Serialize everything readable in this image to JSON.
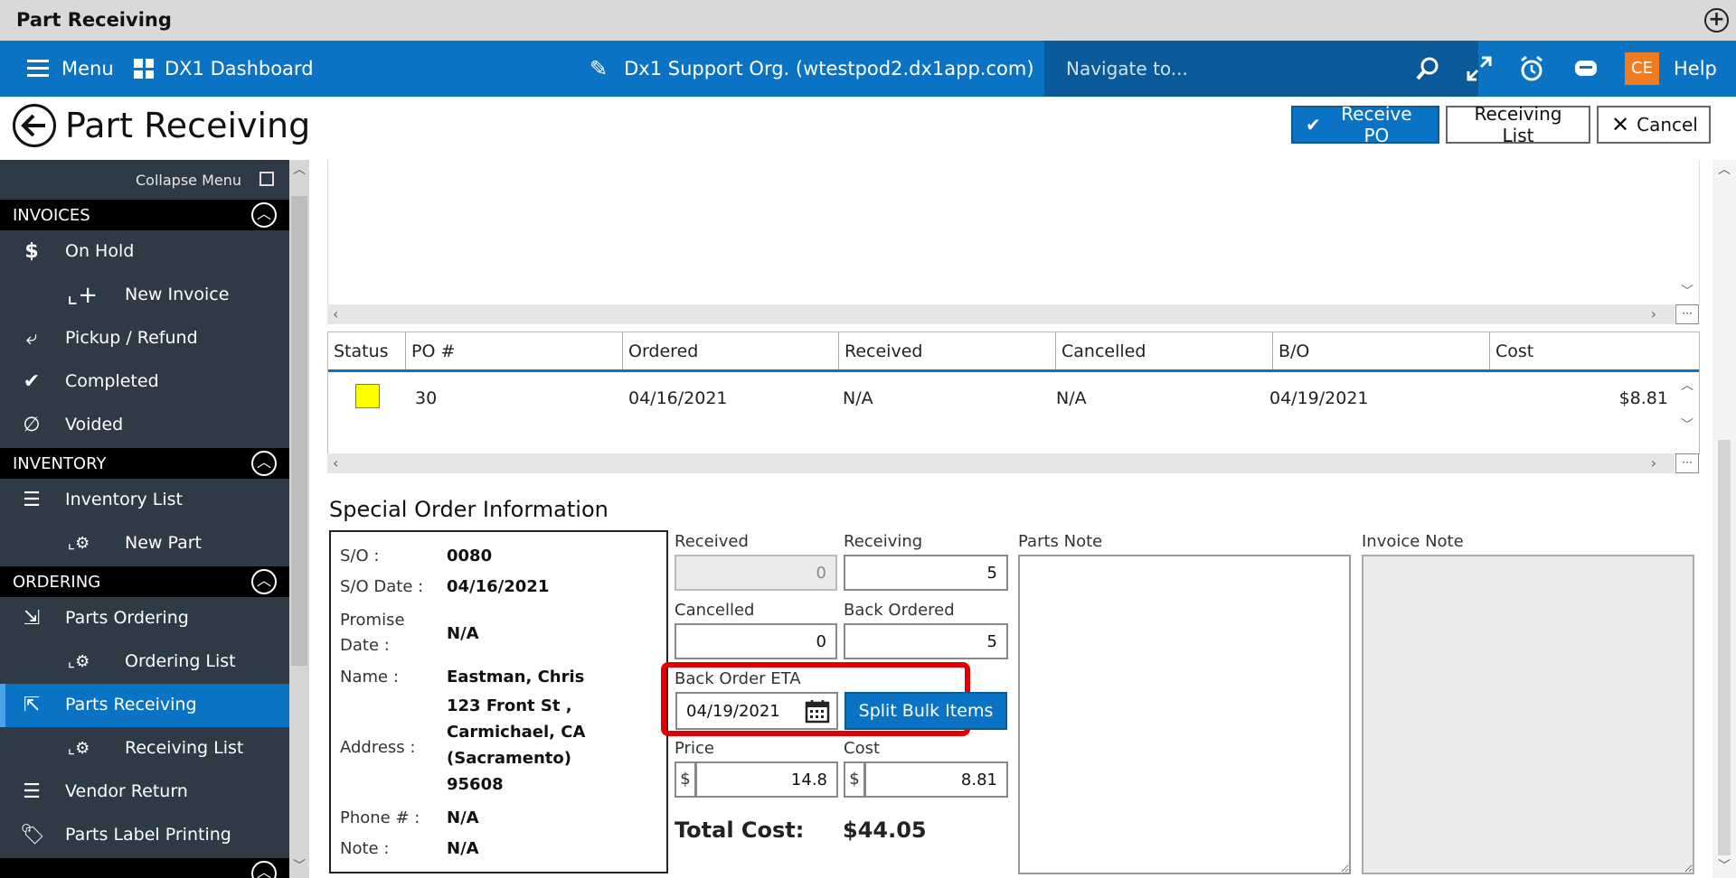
{
  "window": {
    "title": "Part Receiving"
  },
  "nav": {
    "menu_label": "Menu",
    "dashboard_label": "DX1 Dashboard",
    "org_label": "Dx1 Support Org. (wtestpod2.dx1app.com)",
    "search_placeholder": "Navigate to...",
    "user_initials": "CE",
    "help_label": "Help",
    "accent_color": "#0b73c4",
    "user_badge_color": "#f07b21"
  },
  "header": {
    "title": "Part Receiving",
    "receive_po_label": "Receive PO",
    "receiving_list_label": "Receiving List",
    "cancel_label": "Cancel"
  },
  "sidebar": {
    "collapse_label": "Collapse Menu",
    "sections": [
      {
        "title": "INVOICES",
        "items": [
          {
            "label": "On Hold",
            "icon": "dollar-icon"
          },
          {
            "label": "New Invoice",
            "icon": "plus-icon",
            "sub": true
          },
          {
            "label": "Pickup / Refund",
            "icon": "refund-icon"
          },
          {
            "label": "Completed",
            "icon": "check-icon"
          },
          {
            "label": "Voided",
            "icon": "void-icon"
          }
        ]
      },
      {
        "title": "INVENTORY",
        "items": [
          {
            "label": "Inventory List",
            "icon": "list-icon"
          },
          {
            "label": "New Part",
            "icon": "gear-icon",
            "sub": true
          }
        ]
      },
      {
        "title": "ORDERING",
        "items": [
          {
            "label": "Parts Ordering",
            "icon": "order-icon"
          },
          {
            "label": "Ordering List",
            "icon": "gear-icon",
            "sub": true
          },
          {
            "label": "Parts Receiving",
            "icon": "receiving-icon",
            "active": true
          },
          {
            "label": "Receiving List",
            "icon": "gear-icon",
            "sub": true
          },
          {
            "label": "Vendor Return",
            "icon": "list-icon"
          },
          {
            "label": "Parts Label Printing",
            "icon": "label-icon"
          }
        ]
      }
    ]
  },
  "po_table": {
    "columns": [
      "Status",
      "PO #",
      "Ordered",
      "Received",
      "Cancelled",
      "B/O",
      "Cost"
    ],
    "rows": [
      {
        "status_color": "#ffff00",
        "po": "30",
        "ordered": "04/16/2021",
        "received": "N/A",
        "cancelled": "N/A",
        "bo": "04/19/2021",
        "cost": "$8.81"
      }
    ]
  },
  "special_order": {
    "title": "Special Order Information",
    "so_label": "S/O :",
    "so_value": "0080",
    "so_date_label": "S/O Date :",
    "so_date_value": "04/16/2021",
    "promise_label": "Promise Date :",
    "promise_value": "N/A",
    "name_label": "Name :",
    "name_value": "Eastman, Chris",
    "address_label": "Address :",
    "address_lines": [
      "123 Front St ,",
      "Carmichael, CA",
      "(Sacramento)",
      "95608"
    ],
    "phone_label": "Phone # :",
    "phone_value": "N/A",
    "note_label": "Note :",
    "note_value": "N/A"
  },
  "fields": {
    "received_label": "Received",
    "received_value": "0",
    "receiving_label": "Receiving",
    "receiving_value": "5",
    "cancelled_label": "Cancelled",
    "cancelled_value": "0",
    "back_ordered_label": "Back Ordered",
    "back_ordered_value": "5",
    "eta_label": "Back Order ETA",
    "eta_value": "04/19/2021",
    "split_label": "Split Bulk Items",
    "price_label": "Price",
    "price_value": "14.8",
    "cost_label": "Cost",
    "cost_value": "8.81",
    "currency": "$",
    "total_label": "Total Cost:",
    "total_value": "$44.05"
  },
  "notes": {
    "parts_label": "Parts Note",
    "invoice_label": "Invoice Note"
  }
}
